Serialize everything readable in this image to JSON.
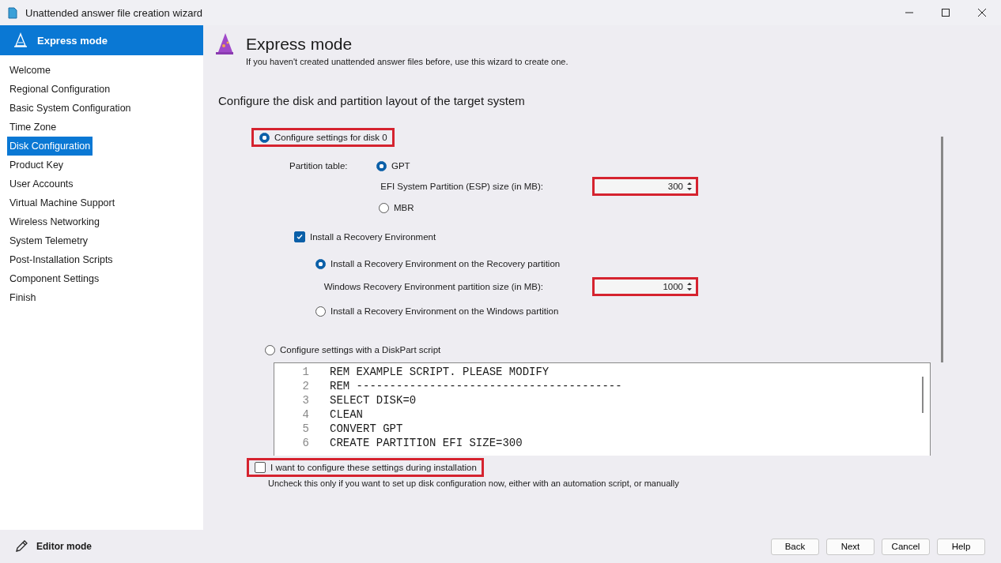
{
  "window": {
    "title": "Unattended answer file creation wizard"
  },
  "sidebar": {
    "header": "Express mode",
    "items": [
      {
        "label": "Welcome",
        "selected": false
      },
      {
        "label": "Regional Configuration",
        "selected": false
      },
      {
        "label": "Basic System Configuration",
        "selected": false
      },
      {
        "label": "Time Zone",
        "selected": false
      },
      {
        "label": "Disk Configuration",
        "selected": true
      },
      {
        "label": "Product Key",
        "selected": false
      },
      {
        "label": "User Accounts",
        "selected": false
      },
      {
        "label": "Virtual Machine Support",
        "selected": false
      },
      {
        "label": "Wireless Networking",
        "selected": false
      },
      {
        "label": "System Telemetry",
        "selected": false
      },
      {
        "label": "Post-Installation Scripts",
        "selected": false
      },
      {
        "label": "Component Settings",
        "selected": false
      },
      {
        "label": "Finish",
        "selected": false
      }
    ],
    "footer": "Editor mode"
  },
  "header": {
    "title": "Express mode",
    "subtitle": "If you haven't created unattended answer files before, use this wizard to create one."
  },
  "section_title": "Configure the disk and partition layout of the target system",
  "disk_option": {
    "label": "Configure settings for disk 0",
    "selected": true,
    "highlighted": true
  },
  "partition_table": {
    "label": "Partition table:",
    "options": [
      {
        "label": "GPT",
        "selected": true
      },
      {
        "label": "MBR",
        "selected": false
      }
    ]
  },
  "esp_size": {
    "label": "EFI System Partition (ESP) size (in MB):",
    "value": "300",
    "highlighted": true
  },
  "recovery": {
    "label": "Install a Recovery Environment",
    "checked": true,
    "options": [
      {
        "label": "Install a Recovery Environment on the Recovery partition",
        "selected": true
      },
      {
        "label": "Install a Recovery Environment on the Windows partition",
        "selected": false
      }
    ]
  },
  "winre_size": {
    "label": "Windows Recovery Environment partition size (in MB):",
    "value": "1000",
    "highlighted": true
  },
  "diskpart_option": {
    "label": "Configure settings with a DiskPart script",
    "selected": false
  },
  "script": {
    "lines": [
      {
        "number": "1",
        "text": "REM EXAMPLE SCRIPT. PLEASE MODIFY"
      },
      {
        "number": "2",
        "text": "REM ----------------------------------------"
      },
      {
        "number": "3",
        "text": "SELECT DISK=0"
      },
      {
        "number": "4",
        "text": "CLEAN"
      },
      {
        "number": "5",
        "text": "CONVERT GPT"
      },
      {
        "number": "6",
        "text": "CREATE PARTITION EFI SIZE=300"
      }
    ]
  },
  "install_time": {
    "label": "I want to configure these settings during installation",
    "checked": false,
    "highlighted": true,
    "hint": "Uncheck this only if you want to set up disk configuration now, either with an automation script, or manually"
  },
  "buttons": [
    "Back",
    "Next",
    "Cancel",
    "Help"
  ]
}
